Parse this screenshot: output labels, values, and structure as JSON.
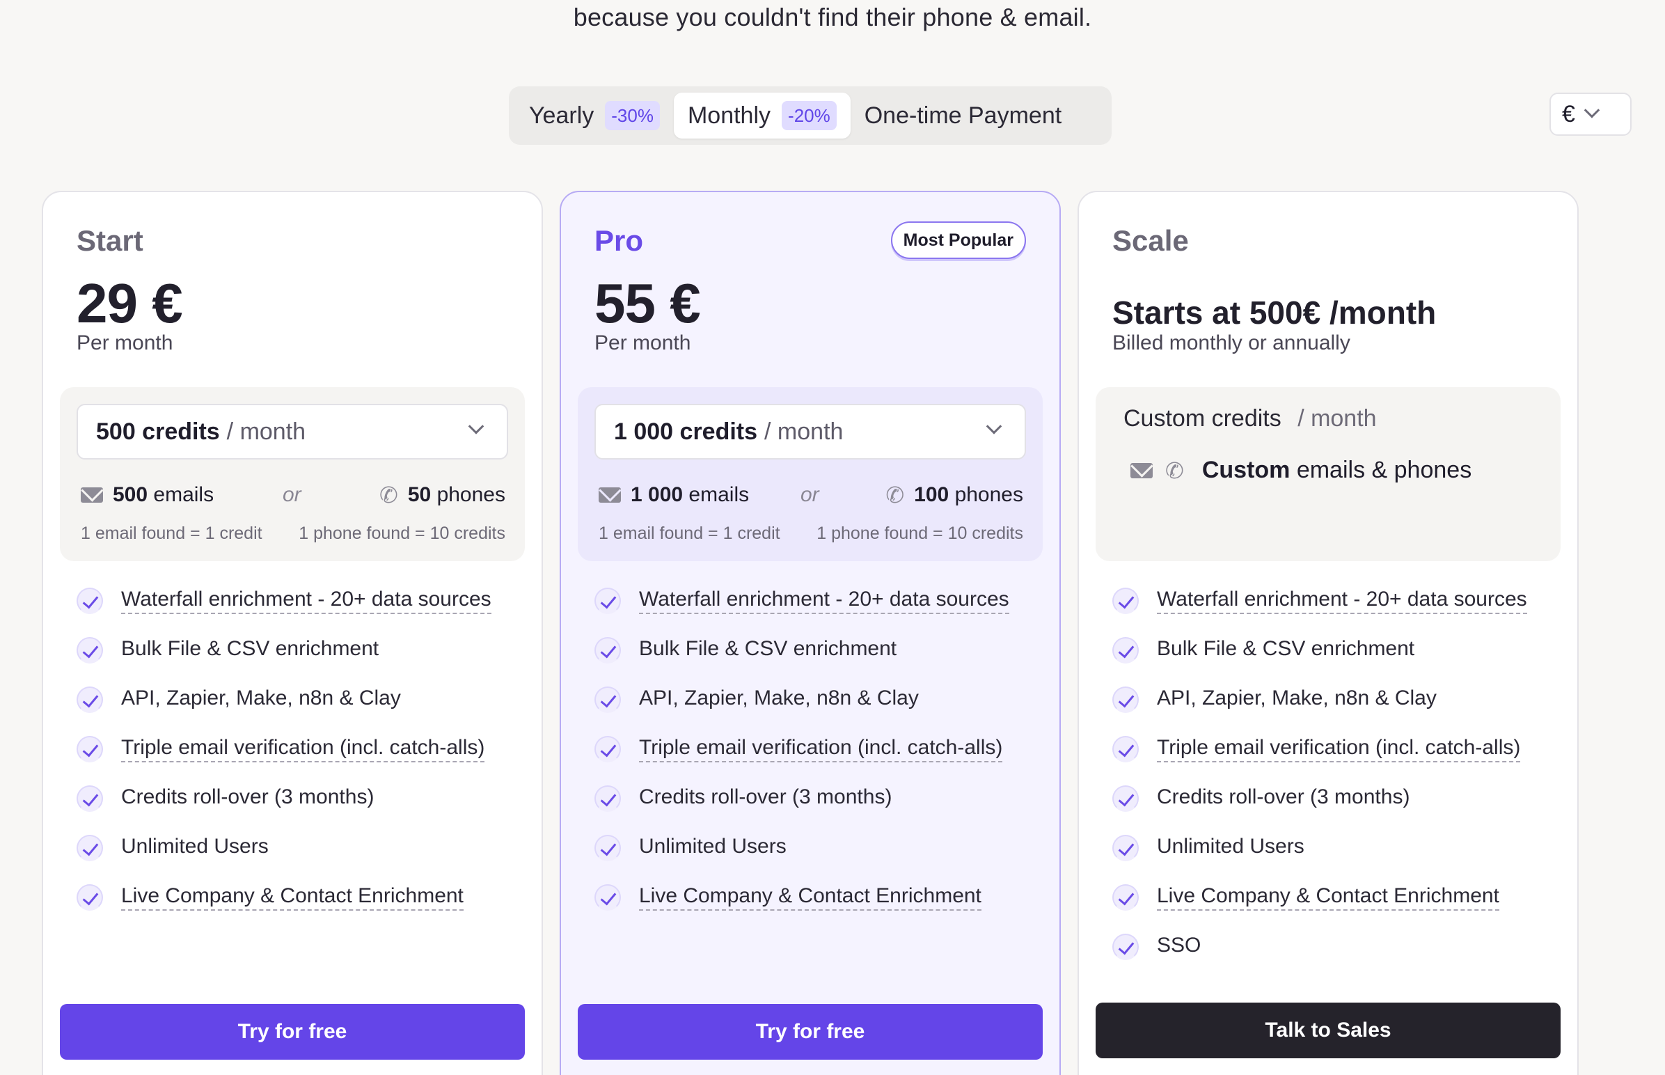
{
  "header": {
    "subtitle": "because you couldn't find their phone & email."
  },
  "billing": {
    "options": [
      {
        "label": "Yearly",
        "discount": "-30%"
      },
      {
        "label": "Monthly",
        "discount": "-20%"
      },
      {
        "label": "One-time Payment"
      }
    ],
    "selected": "Monthly"
  },
  "currency": {
    "value": "€"
  },
  "colors": {
    "accent": "#6445e8",
    "dark_button": "#25232b",
    "pro_bg": "#f5f3ff"
  },
  "plans": [
    {
      "name": "Start",
      "price": "29 €",
      "period": "Per month",
      "credits_amount": "500 credits",
      "credits_unit": "/ month",
      "emails": "500",
      "emails_label": "emails",
      "or": "or",
      "phones": "50",
      "phones_label": "phones",
      "email_note": "1 email found = 1 credit",
      "phone_note": "1 phone found = 10 credits",
      "features": [
        "Waterfall enrichment  - 20+ data sources",
        "Bulk File & CSV enrichment",
        "API, Zapier, Make, n8n & Clay",
        "Triple email verification (incl. catch-alls)",
        "Credits roll-over (3 months)",
        "Unlimited Users",
        "Live Company & Contact Enrichment"
      ],
      "cta": "Try for free"
    },
    {
      "name": "Pro",
      "badge": "Most Popular",
      "price": "55 €",
      "period": "Per month",
      "credits_amount": "1 000 credits",
      "credits_unit": "/ month",
      "emails": "1 000",
      "emails_label": "emails",
      "or": "or",
      "phones": "100",
      "phones_label": "phones",
      "email_note": "1 email found = 1 credit",
      "phone_note": "1 phone found = 10 credits",
      "features": [
        "Waterfall enrichment  - 20+ data sources",
        "Bulk File & CSV enrichment",
        "API, Zapier, Make, n8n & Clay",
        "Triple email verification (incl. catch-alls)",
        "Credits roll-over (3 months)",
        "Unlimited Users",
        "Live Company & Contact Enrichment"
      ],
      "cta": "Try for free"
    },
    {
      "name": "Scale",
      "price": "Starts at 500€ /month",
      "period": "Billed monthly or annually",
      "credits_amount": "Custom credits",
      "credits_unit": "/ month",
      "custom_label": "Custom",
      "custom_rest": "emails & phones",
      "features": [
        "Waterfall enrichment  - 20+ data sources",
        "Bulk File & CSV enrichment",
        "API, Zapier, Make, n8n & Clay",
        "Triple email verification (incl. catch-alls)",
        "Credits roll-over (3 months)",
        "Unlimited Users",
        "Live Company & Contact Enrichment",
        "SSO"
      ],
      "cta": "Talk to Sales"
    }
  ]
}
